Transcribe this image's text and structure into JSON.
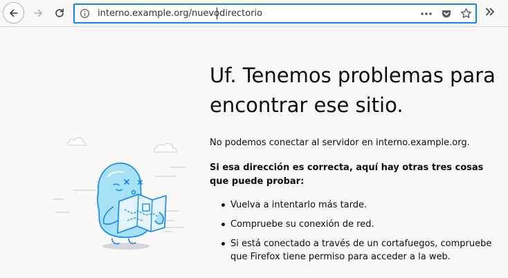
{
  "browser": {
    "url": "interno.example.org/nuevodirectorio"
  },
  "error_page": {
    "title": "Uf. Tenemos problemas para encontrar ese sitio.",
    "intro": "No podemos conectar al servidor en interno.example.org.",
    "suggestions_heading": "Si esa dirección es correcta, aquí hay otras tres cosas que puede probar:",
    "suggestions": [
      "Vuelva a intentarlo más tarde.",
      "Compruebe su conexión de red.",
      "Si está conectado a través de un cortafuegos, compruebe que Firefox tiene permiso para acceder a la web."
    ]
  },
  "icons": {
    "back": "arrow-left-icon",
    "forward": "arrow-right-icon",
    "reload": "reload-icon",
    "info": "info-icon",
    "page_actions": "ellipsis-icon",
    "pocket": "pocket-icon",
    "bookmark": "star-icon",
    "overflow": "chevron-double-right-icon"
  },
  "colors": {
    "focus_ring": "#0a84ff",
    "page_background": "#f9f9fa",
    "illustration_blue": "#a7e1f7"
  }
}
